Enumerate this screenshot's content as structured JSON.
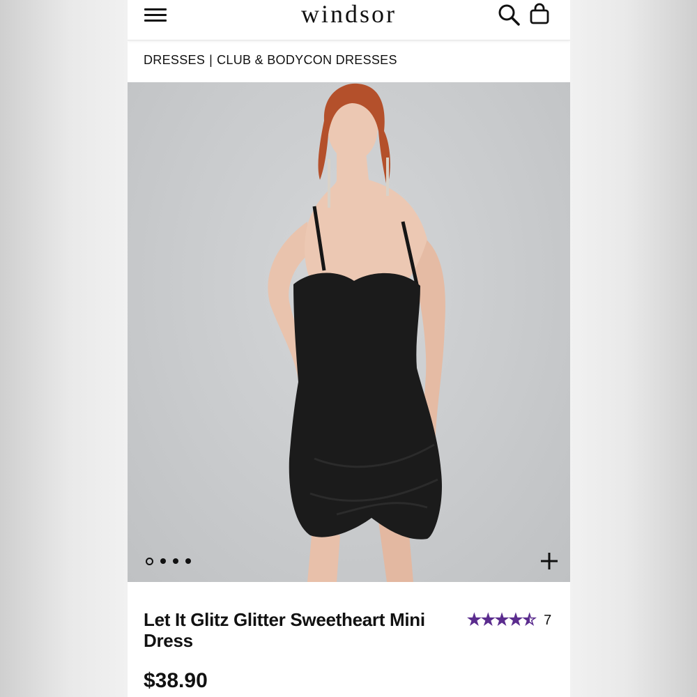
{
  "header": {
    "brand": "WINDSOR",
    "menu_icon": "hamburger-menu-icon",
    "search_icon": "search-icon",
    "bag_icon": "shopping-bag-icon"
  },
  "breadcrumb": {
    "items": [
      "DRESSES",
      "CLUB & BODYCON DRESSES"
    ],
    "separator": "|"
  },
  "gallery": {
    "image_count": 4,
    "active_index": 0,
    "zoom_icon": "plus-icon"
  },
  "product": {
    "title": "Let It Glitz Glitter Sweetheart Mini Dress",
    "price": "$38.90",
    "rating": 4.5,
    "rating_max": 5,
    "review_count": "7",
    "star_color": "#5b2c8e"
  }
}
